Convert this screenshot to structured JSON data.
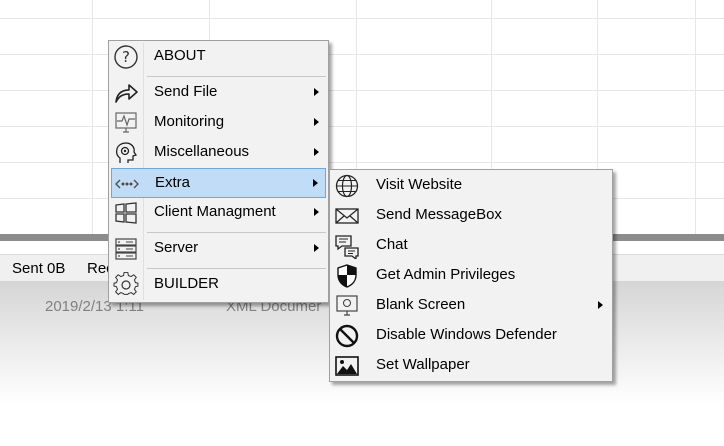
{
  "background": {
    "status": {
      "sent": "Sent 0B",
      "received": "Rec"
    },
    "file_row": {
      "date": "2019/2/13 1:11",
      "type": "XML Documer"
    }
  },
  "main_menu": {
    "about": "ABOUT",
    "send_file": "Send File",
    "monitoring": "Monitoring",
    "miscellaneous": "Miscellaneous",
    "extra": "Extra",
    "client_management": "Client Managment",
    "server": "Server",
    "builder": "BUILDER"
  },
  "extra_menu": {
    "visit_website": "Visit Website",
    "send_messagebox": "Send MessageBox",
    "chat": "Chat",
    "admin_privileges": "Get Admin Privileges",
    "blank_screen": "Blank Screen",
    "disable_defender": "Disable Windows Defender",
    "set_wallpaper": "Set Wallpaper"
  },
  "icons": {
    "about": "question-icon",
    "send_file": "share-arrow-icon",
    "monitoring": "monitor-pulse-icon",
    "miscellaneous": "gear-head-icon",
    "extra": "network-dots-icon",
    "client_management": "windows-icon",
    "server": "server-icon",
    "builder": "gear-icon",
    "visit_website": "globe-icon",
    "send_messagebox": "envelope-icon",
    "chat": "chat-icon",
    "admin_privileges": "shield-icon",
    "blank_screen": "desktop-icon",
    "disable_defender": "prohibit-icon",
    "set_wallpaper": "image-icon"
  },
  "colors": {
    "menu_bg": "#f2f2f2",
    "highlight": "#c1dcf6",
    "highlight_border": "#6aa9e0"
  }
}
